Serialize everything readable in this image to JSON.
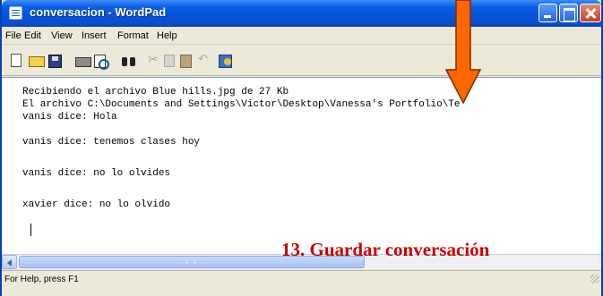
{
  "window": {
    "title": "conversacion - WordPad"
  },
  "menubar": {
    "items": [
      "File",
      "Edit",
      "View",
      "Insert",
      "Format",
      "Help"
    ]
  },
  "toolbar": {
    "icons": [
      "new-icon",
      "open-icon",
      "save-icon",
      "print-icon",
      "print-preview-icon",
      "find-icon",
      "cut-icon",
      "copy-icon",
      "paste-icon",
      "undo-icon",
      "date-time-icon"
    ]
  },
  "document": {
    "lines": [
      "Recibiendo el archivo Blue hills.jpg de 27 Kb",
      "El archivo C:\\Documents and Settings\\Victor\\Desktop\\Vanessa's Portfolio\\Te",
      "vanis dice: Hola",
      "",
      "vanis dice: tenemos clases hoy",
      "",
      "vanis dice: no lo olvides",
      "",
      "xavier dice: no lo olvido"
    ]
  },
  "statusbar": {
    "text": "For Help, press F1"
  },
  "annotation": {
    "caption": "13. Guardar conversación",
    "caption_color": "#cc0000",
    "arrow_color": "#ff6600"
  }
}
